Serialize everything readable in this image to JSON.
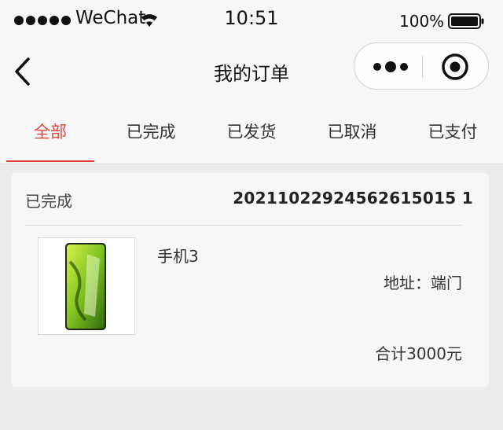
{
  "status_bar": {
    "carrier": "WeChat",
    "time": "10:51",
    "battery": "100%"
  },
  "nav": {
    "title": "我的订单"
  },
  "tabs": [
    {
      "label": "全部",
      "active": true
    },
    {
      "label": "已完成",
      "active": false
    },
    {
      "label": "已发货",
      "active": false
    },
    {
      "label": "已取消",
      "active": false
    },
    {
      "label": "已支付",
      "active": false
    }
  ],
  "order": {
    "status": "已完成",
    "number": "20211022924562615015 1",
    "product_name": "手机3",
    "address_label": "地址：",
    "address_value": "端门",
    "total": "合计3000元"
  },
  "colors": {
    "accent": "#e0463c",
    "background": "#ececef",
    "card": "#f7f7f9"
  },
  "icons": [
    "signal-icon",
    "wifi-icon",
    "battery-icon",
    "back-icon",
    "more-icon",
    "close-icon"
  ]
}
